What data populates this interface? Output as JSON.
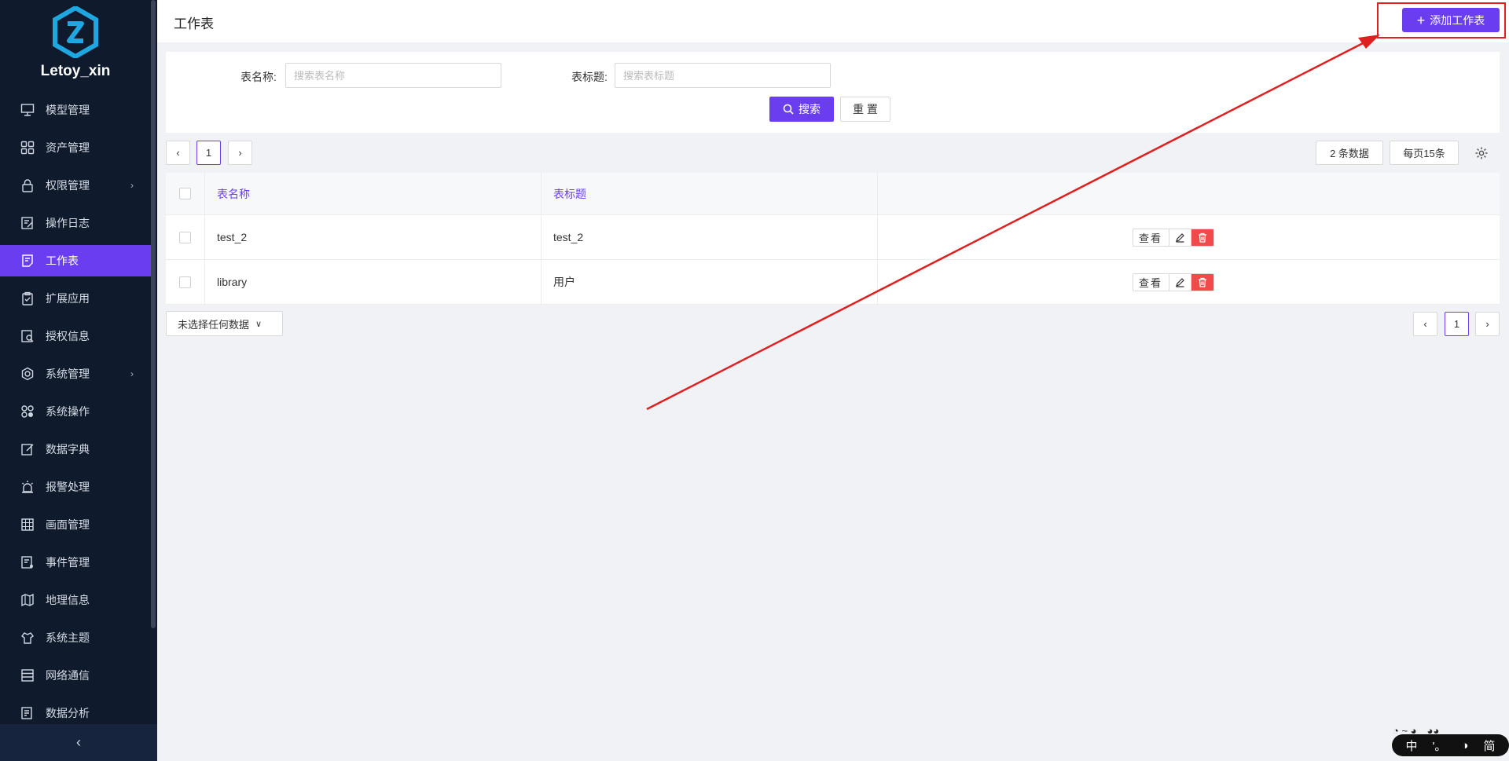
{
  "app": {
    "brand": "Letoy_xin"
  },
  "sidebar": {
    "items": [
      {
        "label": "模型管理",
        "icon": "monitor-settings-icon"
      },
      {
        "label": "资产管理",
        "icon": "grid-icon"
      },
      {
        "label": "权限管理",
        "icon": "lock-icon",
        "has_children": true
      },
      {
        "label": "操作日志",
        "icon": "edit-doc-icon"
      },
      {
        "label": "工作表",
        "icon": "worksheet-icon",
        "active": true
      },
      {
        "label": "扩展应用",
        "icon": "clipboard-check-icon"
      },
      {
        "label": "授权信息",
        "icon": "doc-search-icon"
      },
      {
        "label": "系统管理",
        "icon": "gear-icon",
        "has_children": true
      },
      {
        "label": "系统操作",
        "icon": "circles-icon"
      },
      {
        "label": "数据字典",
        "icon": "edit-icon"
      },
      {
        "label": "报警处理",
        "icon": "alarm-icon"
      },
      {
        "label": "画面管理",
        "icon": "canvas-grid-icon"
      },
      {
        "label": "事件管理",
        "icon": "event-doc-icon"
      },
      {
        "label": "地理信息",
        "icon": "map-icon"
      },
      {
        "label": "系统主题",
        "icon": "theme-icon"
      },
      {
        "label": "网络通信",
        "icon": "list-icon"
      },
      {
        "label": "数据分析",
        "icon": "report-icon"
      }
    ],
    "collapse_glyph": "‹"
  },
  "header": {
    "title": "工作表",
    "add_label": "添加工作表"
  },
  "search": {
    "name_label": "表名称:",
    "name_placeholder": "搜索表名称",
    "title_label": "表标题:",
    "title_placeholder": "搜索表标题",
    "search_label": "搜索",
    "reset_label": "重 置"
  },
  "pagination": {
    "current_page": "1",
    "total_text": "2 条数据",
    "page_size_text": "每页15条"
  },
  "table": {
    "columns": [
      "表名称",
      "表标题"
    ],
    "rows": [
      {
        "name": "test_2",
        "title": "test_2"
      },
      {
        "name": "library",
        "title": "用户"
      }
    ],
    "view_label": "查看"
  },
  "selection": {
    "label": "未选择任何数据"
  },
  "ime": {
    "lang": "中",
    "punct": "'。",
    "mode": "简"
  },
  "colors": {
    "accent": "#6a3ef0",
    "danger": "#f04a4a",
    "sidebar_bg": "#0f1b2d",
    "annotation": "#e02020"
  }
}
